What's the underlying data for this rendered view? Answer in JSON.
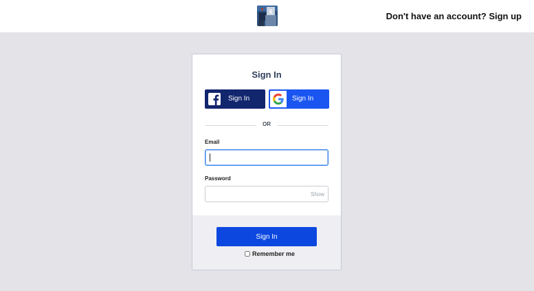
{
  "header": {
    "logo_icon": "avatar-logo-icon",
    "signup_text": "Don't have an account? Sign up"
  },
  "card": {
    "title": "Sign In",
    "facebook": {
      "label": "Sign In",
      "icon": "facebook-icon",
      "color": "#12266e"
    },
    "google": {
      "label": "Sign In",
      "icon": "google-icon",
      "color": "#1a55f1"
    },
    "divider_text": "OR",
    "email": {
      "label": "Email",
      "value": "",
      "placeholder": ""
    },
    "password": {
      "label": "Password",
      "value": "",
      "placeholder": "",
      "show_label": "Show"
    },
    "submit_label": "Sign In",
    "remember_label": "Remember me",
    "remember_checked": false
  },
  "colors": {
    "page_background": "#e3e3e8",
    "primary_button": "#0c48e0",
    "focus_border": "#2f7fe8"
  }
}
